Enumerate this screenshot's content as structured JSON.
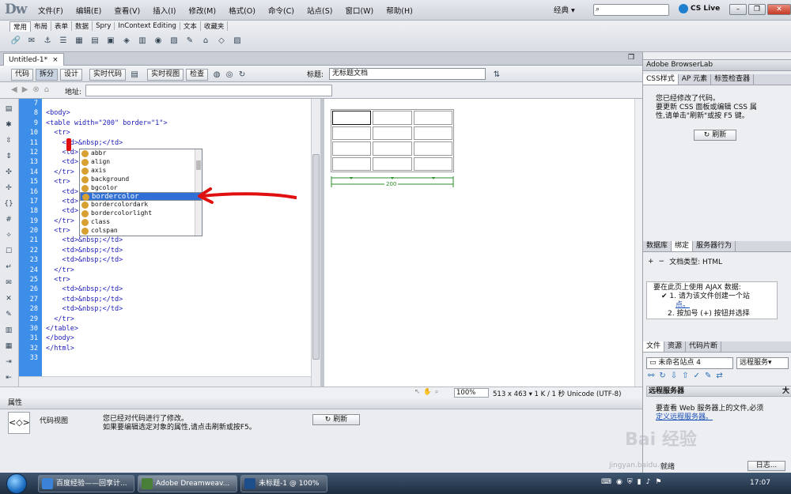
{
  "app": {
    "logo": "Dw",
    "layout": "经典 ▾",
    "cslive": "CS Live"
  },
  "menu": [
    "文件(F)",
    "编辑(E)",
    "查看(V)",
    "插入(I)",
    "修改(M)",
    "格式(O)",
    "命令(C)",
    "站点(S)",
    "窗口(W)",
    "帮助(H)"
  ],
  "insert_tabs": [
    "常用",
    "布局",
    "表单",
    "数据",
    "Spry",
    "InContext Editing",
    "文本",
    "收藏夹"
  ],
  "document": {
    "tab": "Untitled-1*",
    "close": "×"
  },
  "doc_toolbar": {
    "code": "代码",
    "split": "拆分",
    "design": "设计",
    "live_code": "实时代码",
    "live_view": "实时视图",
    "inspect": "检查",
    "title_label": "标题:",
    "title_value": "无标题文档"
  },
  "address": {
    "label": "地址:",
    "value": ""
  },
  "code": {
    "line_numbers": [
      "7",
      "8",
      "9",
      "10",
      "11",
      "12",
      "13",
      "14",
      "15",
      "16",
      "17",
      "18",
      "19",
      "20",
      "21",
      "22",
      "23",
      "24",
      "25",
      "26",
      "27",
      "28",
      "29",
      "30",
      "31",
      "32",
      "33"
    ],
    "lines": [
      "",
      "<body>",
      "<table width=\"200\" border=\"1\">",
      "  <tr>",
      "    <td>&nbsp;</td>",
      "    <td>",
      "    <td>",
      "  </tr>",
      "  <tr>",
      "    <td>",
      "    <td>",
      "    <td>",
      "  </tr>",
      "  <tr>",
      "    <td>&nbsp;</td>",
      "    <td>&nbsp;</td>",
      "    <td>&nbsp;</td>",
      "  </tr>",
      "  <tr>",
      "    <td>&nbsp;</td>",
      "    <td>&nbsp;</td>",
      "    <td>&nbsp;</td>",
      "  </tr>",
      "</table>",
      "</body>",
      "</html>",
      ""
    ]
  },
  "autocomplete": {
    "items": [
      "abbr",
      "align",
      "axis",
      "background",
      "bgcolor",
      "bordercolor",
      "bordercolordark",
      "bordercolorlight",
      "class",
      "colspan"
    ],
    "selected_index": 5
  },
  "design": {
    "width_label": "200"
  },
  "status": {
    "zoom": "100%",
    "dims": "513 x 463 ▾ 1 K / 1 秒 Unicode (UTF-8)"
  },
  "properties": {
    "tab": "属性",
    "icon": "<◇>",
    "view_label": "代码视图",
    "message_1": "您已经对代码进行了修改。",
    "message_2": "如果要编辑选定对象的属性,请点击刷新或按F5。",
    "refresh": "刷新"
  },
  "right_panels": {
    "browserlab": "Adobe BrowserLab",
    "css_tabs": [
      "CSS样式",
      "AP 元素",
      "标签检查器"
    ],
    "css_msg_1": "您已经修改了代码。",
    "css_msg_2": "要更新 CSS 面板或编辑 CSS 属",
    "css_msg_3": "性,请单击\"刷新\"或按 F5 键。",
    "refresh": "刷新",
    "bind_tabs": [
      "数据库",
      "绑定",
      "服务器行为"
    ],
    "doc_type": "文档类型: HTML",
    "ajax_1": "要在此页上使用 AJAX 数据:",
    "ajax_2": "1. 请为该文件创建一个站",
    "ajax_2b": "点。",
    "ajax_3": "2. 按加号 (+) 按钮并选择",
    "file_tabs": [
      "文件",
      "资源",
      "代码片断"
    ],
    "site_select": "未命名站点 4",
    "server_select": "远程服务▾",
    "remote_head": "远程服务器",
    "remote_head2": "大",
    "remote_msg_1": "要查看 Web 服务器上的文件,必须",
    "remote_msg_2": "定义远程服务器。",
    "ready": "就绪",
    "log": "日志..."
  },
  "taskbar": {
    "tasks": [
      "百度经验——回享计...",
      "Adobe Dreamweav...",
      "未标题-1 @ 100%(..."
    ],
    "clock": "17:07"
  },
  "watermark": {
    "text": "Bai 经验",
    "url": "jingyan.baidu.com"
  }
}
